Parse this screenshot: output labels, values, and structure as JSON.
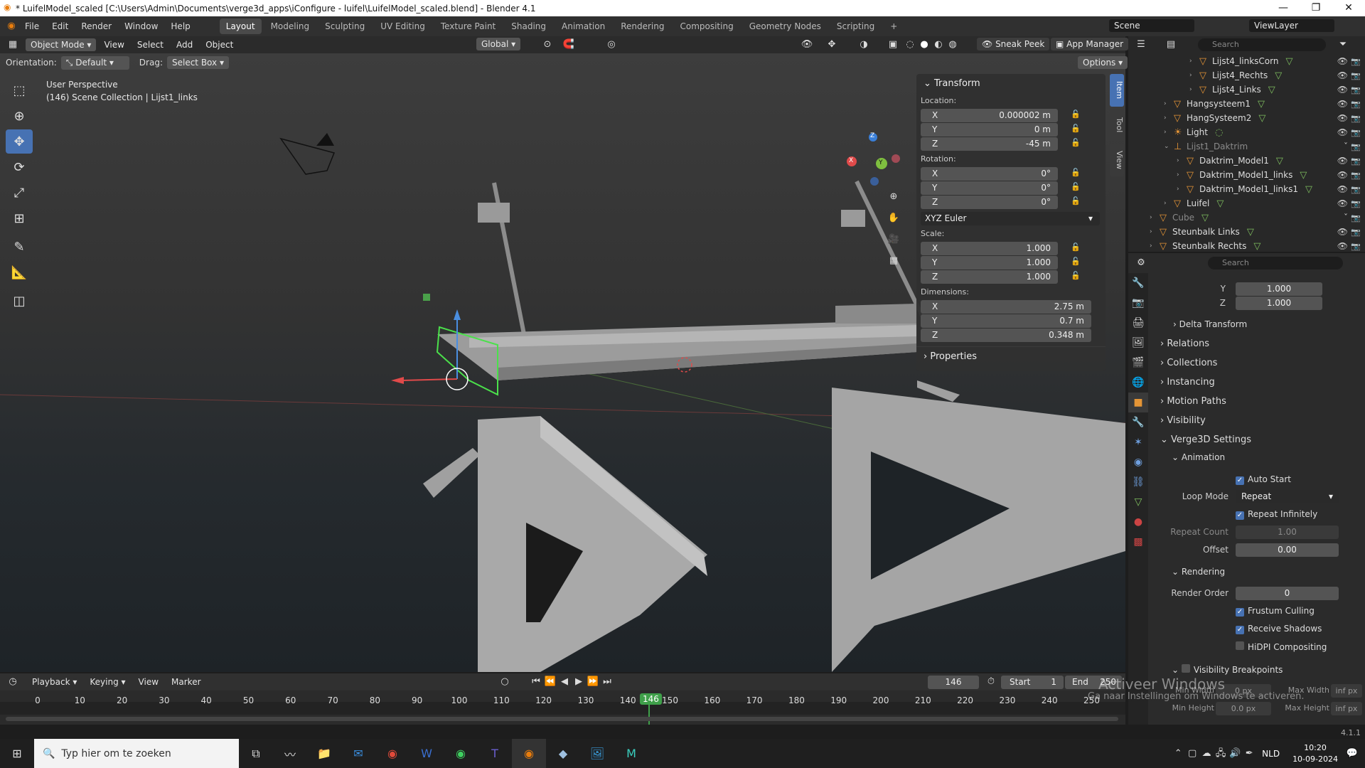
{
  "window": {
    "title": "* LuifelModel_scaled [C:\\Users\\Admin\\Documents\\verge3d_apps\\iConfigure - luifel\\LuifelModel_scaled.blend] - Blender 4.1",
    "min": "—",
    "restore": "❐",
    "close": "✕"
  },
  "menubar": {
    "menus": [
      "File",
      "Edit",
      "Render",
      "Window",
      "Help"
    ],
    "workspaces": [
      "Layout",
      "Modeling",
      "Sculpting",
      "UV Editing",
      "Texture Paint",
      "Shading",
      "Animation",
      "Rendering",
      "Compositing",
      "Geometry Nodes",
      "Scripting"
    ],
    "add_tab": "+",
    "scene": "Scene",
    "viewlayer": "ViewLayer"
  },
  "viewport_header": {
    "mode": "Object Mode",
    "menus": [
      "View",
      "Select",
      "Add",
      "Object"
    ],
    "transform_orientation": "Global",
    "sneak_peek": "Sneak Peek",
    "app_manager": "App Manager",
    "options": "Options"
  },
  "tool_settings": {
    "orientation_label": "Orientation:",
    "orientation_value": "Default",
    "drag_label": "Drag:",
    "drag_value": "Select Box"
  },
  "viewport_info": {
    "view": "User Perspective",
    "collection": "(146) Scene Collection | Lijst1_links"
  },
  "gizmo_axes": {
    "x": "X",
    "y": "Y",
    "z": "Z"
  },
  "npanel": {
    "header": "Transform",
    "location_label": "Location:",
    "location": [
      {
        "k": "X",
        "v": "0.000002 m"
      },
      {
        "k": "Y",
        "v": "0 m"
      },
      {
        "k": "Z",
        "v": "-45 m"
      }
    ],
    "rotation_label": "Rotation:",
    "rotation": [
      {
        "k": "X",
        "v": "0°"
      },
      {
        "k": "Y",
        "v": "0°"
      },
      {
        "k": "Z",
        "v": "0°"
      }
    ],
    "rotation_mode": "XYZ Euler",
    "scale_label": "Scale:",
    "scale": [
      {
        "k": "X",
        "v": "1.000"
      },
      {
        "k": "Y",
        "v": "1.000"
      },
      {
        "k": "Z",
        "v": "1.000"
      }
    ],
    "dimensions_label": "Dimensions:",
    "dimensions": [
      {
        "k": "X",
        "v": "2.75 m"
      },
      {
        "k": "Y",
        "v": "0.7 m"
      },
      {
        "k": "Z",
        "v": "0.348 m"
      }
    ],
    "properties": "Properties",
    "tabs": [
      "Item",
      "Tool",
      "View"
    ]
  },
  "outliner": {
    "search_placeholder": "Search",
    "items": [
      {
        "name": "Lijst4_linksCorn",
        "dim": false
      },
      {
        "name": "Lijst4_Rechts",
        "dim": false
      },
      {
        "name": "Lijst4_Links",
        "dim": false
      },
      {
        "name": "Hangsysteem1",
        "dim": false
      },
      {
        "name": "HangSysteem2",
        "dim": false
      },
      {
        "name": "Light",
        "dim": false
      },
      {
        "name": "Lijst1_Daktrim",
        "dim": true
      },
      {
        "name": "Daktrim_Model1",
        "dim": false
      },
      {
        "name": "Daktrim_Model1_links",
        "dim": false
      },
      {
        "name": "Daktrim_Model1_links1",
        "dim": false
      },
      {
        "name": "Luifel",
        "dim": false
      },
      {
        "name": "Cube",
        "dim": true
      },
      {
        "name": "Steunbalk Links",
        "dim": false
      },
      {
        "name": "Steunbalk Rechts",
        "dim": false
      }
    ]
  },
  "properties": {
    "search_placeholder": "Search",
    "scale_y_label": "Y",
    "scale_y": "1.000",
    "scale_z_label": "Z",
    "scale_z": "1.000",
    "sections": [
      "Delta Transform",
      "Relations",
      "Collections",
      "Instancing",
      "Motion Paths",
      "Visibility"
    ],
    "verge3d": "Verge3D Settings",
    "animation": "Animation",
    "auto_start": "Auto Start",
    "loop_mode_label": "Loop Mode",
    "loop_mode": "Repeat",
    "repeat_infinitely": "Repeat Infinitely",
    "repeat_count_label": "Repeat Count",
    "repeat_count": "1.00",
    "offset_label": "Offset",
    "offset": "0.00",
    "rendering": "Rendering",
    "render_order_label": "Render Order",
    "render_order": "0",
    "frustum_culling": "Frustum Culling",
    "receive_shadows": "Receive Shadows",
    "hidpi": "HiDPI Compositing",
    "visibility_breakpoints": "Visibility Breakpoints",
    "min_width_label": "Min Width",
    "min_width": "0 px",
    "max_width_label": "Max Width",
    "max_width": "inf px",
    "min_height_label": "Min Height",
    "min_height": "0.0 px",
    "max_height_label": "Max Height",
    "max_height": "inf px"
  },
  "timeline": {
    "menus": [
      "Playback",
      "Keying",
      "View",
      "Marker"
    ],
    "current_frame": "146",
    "start_label": "Start",
    "start": "1",
    "end_label": "End",
    "end": "250",
    "ticks": [
      "0",
      "10",
      "20",
      "30",
      "40",
      "50",
      "60",
      "70",
      "80",
      "90",
      "100",
      "110",
      "120",
      "130",
      "140",
      "150",
      "160",
      "170",
      "180",
      "190",
      "200",
      "210",
      "220",
      "230",
      "240",
      "250"
    ]
  },
  "watermark": {
    "line1": "Activeer Windows",
    "line2": "Ga naar Instellingen om Windows te activeren."
  },
  "version": "4.1.1",
  "taskbar": {
    "search_placeholder": "Typ hier om te zoeken",
    "language": "NLD",
    "time": "10:20",
    "date": "10-09-2024"
  }
}
